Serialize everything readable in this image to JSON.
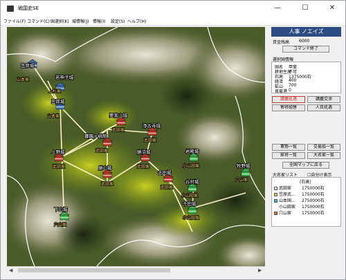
{
  "window": {
    "title": "戦国史SE"
  },
  "menu": [
    "ファイル(F)",
    "コマンド(C)",
    "国選択(K)",
    "城情報(J)",
    "情報(I)",
    "設定(S)",
    "ヘルプ(H)"
  ],
  "castles": {
    "c1": {
      "name": "笠原城",
      "clan": "山本家"
    },
    "c2": {
      "name": "若神子城",
      "clan": "上杉家"
    },
    "c3": {
      "name": "五郎城",
      "clan": "山本家"
    },
    "c4": {
      "name": "要害山城",
      "clan": "武田家"
    },
    "c5": {
      "name": "躑躅ヶ崎館",
      "clan": "武田家"
    },
    "c6": {
      "name": "浄古寺城",
      "clan": "武田家"
    },
    "c7": {
      "name": "上野城",
      "clan": "武田家"
    },
    "c8": {
      "name": "勝沼城",
      "clan": "武田家"
    },
    "c9": {
      "name": "勝山城",
      "clan": "武田家"
    },
    "c10": {
      "name": "岩殿城",
      "clan": "小山田家"
    },
    "c11": {
      "name": "吉田城",
      "clan": "武田家"
    },
    "c12": {
      "name": "谷村城",
      "clan": "小山田家"
    },
    "c13": {
      "name": "牧野城",
      "clan": "穴山家"
    },
    "c14": {
      "name": "下山城",
      "clan": "穴山家"
    },
    "c15": {
      "name": "千田城",
      "clan": "小山田家"
    }
  },
  "panel": {
    "title": "人事 ノエイズ",
    "money_label": "資金残高",
    "money_value": "6000",
    "end_command": "コマンド終了",
    "sel_label": "選択国情報",
    "info": [
      {
        "k": "国名",
        "v": "甲斐"
      },
      {
        "k": "耕地生産",
        "v": "不可"
      },
      {
        "k": "石高",
        "v": "1375000石"
      },
      {
        "k": "経済",
        "v": "400"
      },
      {
        "k": "鉱山",
        "v": "700"
      },
      {
        "k": "貿易港",
        "v": "0"
      }
    ],
    "buttons": {
      "b1": "講義処遇",
      "b2": "講義交渉",
      "b3": "寄将組替",
      "b4": "人質処遇",
      "b5": "軍勢一覧",
      "b6": "交易船一覧",
      "b7": "家将一覧",
      "b8": "大名家一覧",
      "b9": "全国マップに戻る"
    },
    "daimyo_label": "大名家リスト",
    "self_color_label": "自分け表示",
    "list_header": "(石高)",
    "list": [
      {
        "name": "武田家",
        "value": "1750000石"
      },
      {
        "name": "笠原武...",
        "value": "1750000石"
      },
      {
        "name": "山本国...",
        "value": "2750000石"
      },
      {
        "name": "小山田家",
        "value": "1750000石"
      },
      {
        "name": "穴山家",
        "value": "1750000石"
      }
    ]
  },
  "colors": {
    "title_bar": "#2b4d84",
    "red_castle": "#c0392b",
    "blue_castle": "#3a6fb0",
    "green_castle": "#3bb54a"
  }
}
